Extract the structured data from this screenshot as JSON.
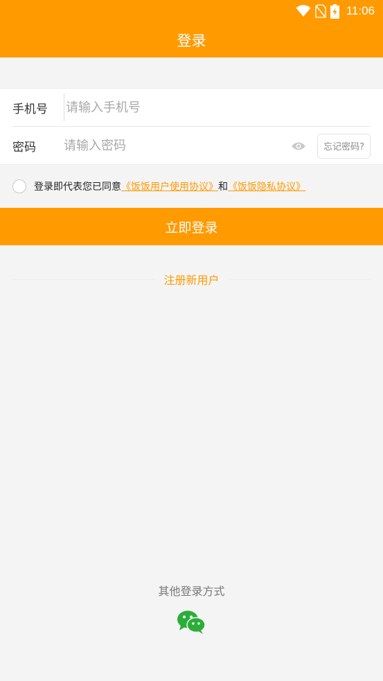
{
  "status_bar": {
    "time": "11:06"
  },
  "app_bar": {
    "title": "登录"
  },
  "form": {
    "phone_label": "手机号",
    "phone_placeholder": "请输入手机号",
    "password_label": "密码",
    "password_placeholder": "请输入密码",
    "forgot_label": "忘记密码?"
  },
  "agreement": {
    "prefix": "登录即代表您已同意",
    "user_agreement": "《饭饭用户使用协议》",
    "conjunction": "和",
    "privacy_agreement": "《饭饭隐私协议》"
  },
  "login_button": {
    "label": "立即登录"
  },
  "register": {
    "label": "注册新用户"
  },
  "other_login": {
    "label": "其他登录方式"
  },
  "colors": {
    "accent": "#ff9a00",
    "background": "#f4f4f4",
    "wechat": "#2aae38"
  },
  "icons": [
    "wifi-icon",
    "no-sim-icon",
    "battery-charging-icon",
    "eye-icon",
    "wechat-icon"
  ]
}
